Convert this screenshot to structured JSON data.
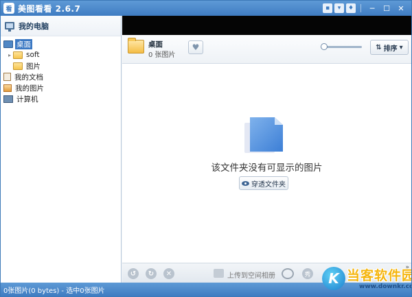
{
  "app": {
    "title": "美图看看 2.6.7",
    "logo_text": "看"
  },
  "title_controls": {
    "icons": [
      "chat-icon",
      "menu-icon",
      "skin-icon",
      "minimize-icon",
      "maximize-icon",
      "close-icon"
    ]
  },
  "sidebar": {
    "header": "我的电脑",
    "items": [
      {
        "label": "桌面",
        "icon": "desktop-icon",
        "selected": true
      },
      {
        "label": "soft",
        "icon": "folder-icon",
        "expandable": true
      },
      {
        "label": "图片",
        "icon": "folder-icon"
      },
      {
        "label": "我的文档",
        "icon": "documents-icon"
      },
      {
        "label": "我的图片",
        "icon": "pictures-icon"
      },
      {
        "label": "计算机",
        "icon": "computer-icon"
      }
    ]
  },
  "toolbar": {
    "folder_name": "桌面",
    "folder_count": "0 张图片",
    "sort_label": "排序"
  },
  "content": {
    "empty_message": "该文件夹没有可显示的图片",
    "browse_button": "穿透文件夹"
  },
  "bottombar": {
    "upload_label": "上传到空间相册"
  },
  "statusbar": {
    "text": "0张图片(0 bytes) - 选中0张图片"
  },
  "watermark": {
    "brand": "当客软件园",
    "url": "www.downkr.com",
    "logo_letter": "K"
  }
}
